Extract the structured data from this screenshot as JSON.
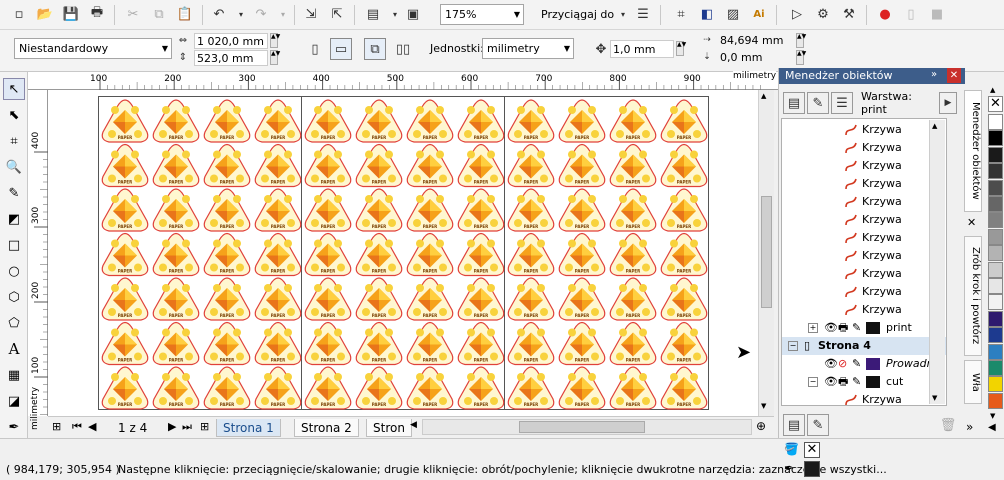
{
  "toolbar": {
    "zoom": "175%",
    "snap_label": "Przyciągaj do"
  },
  "propbar": {
    "page_size": "Niestandardowy",
    "width": "1 020,0 mm",
    "height": "523,0 mm",
    "units_label": "Jednostki:",
    "units_value": "milimetry",
    "nudge": "1,0 mm",
    "pos_x": "84,694 mm",
    "pos_y": "0,0 mm"
  },
  "ruler": {
    "h_ticks": [
      "100",
      "200",
      "300",
      "400",
      "500",
      "600",
      "700",
      "800",
      "900"
    ],
    "h_unit": "milimetry",
    "v_ticks": [
      "400",
      "300",
      "200",
      "100"
    ],
    "v_unit": "milimetry"
  },
  "artwork": {
    "logo_text": "PAPER"
  },
  "pages": {
    "counter": "1 z 4",
    "tabs": [
      "Strona 1",
      "Strona 2",
      "Stron"
    ]
  },
  "docker": {
    "title": "Menedżer obiektów",
    "layer_label": "Warstwa:",
    "layer_value": "print",
    "items": [
      "Krzywa",
      "Krzywa",
      "Krzywa",
      "Krzywa",
      "Krzywa",
      "Krzywa",
      "Krzywa",
      "Krzywa",
      "Krzywa",
      "Krzywa",
      "Krzywa"
    ],
    "print_layer": "print",
    "page4": "Strona 4",
    "guides": "Prowadni",
    "cut_layer": "cut",
    "cut_item": "Krzywa"
  },
  "side_tabs": {
    "t1": "Menedżer obiektów",
    "t2": "Zrób krok i powtórz",
    "t3": "Wła"
  },
  "status": {
    "coords": "( 984,179; 305,954 )",
    "hint": "Następne kliknięcie: przeciągnięcie/skalowanie; drugie kliknięcie: obrót/pochylenie; kliknięcie dwukrotne narzędzia: zaznaczenie wszystki..."
  },
  "colors": {
    "accent": "#3d5d8a",
    "tab_active": "#dbe7f4",
    "logo_fill": "#f6a21a",
    "logo_border": "#e0413a",
    "palette": [
      "#ffffff",
      "#000000",
      "#1a1a1a",
      "#333333",
      "#4d4d4d",
      "#666666",
      "#808080",
      "#999999",
      "#b3b3b3",
      "#cccccc",
      "#e6e6e6",
      "#f2f2f2",
      "#2e1a6e",
      "#1d3a8f",
      "#2c7fc1",
      "#1b8a6b",
      "#f2d400",
      "#e65b1a"
    ]
  }
}
